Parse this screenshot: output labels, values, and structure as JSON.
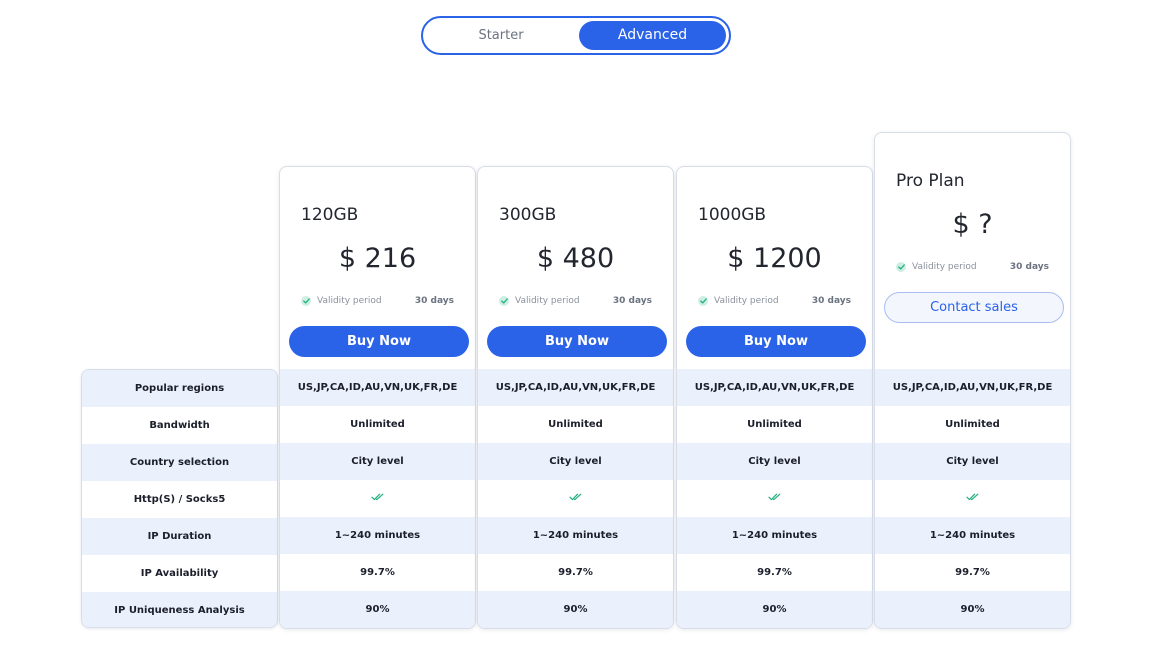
{
  "toggle": {
    "starter": "Starter",
    "advanced": "Advanced",
    "active": "advanced"
  },
  "features": [
    "Popular regions",
    "Bandwidth",
    "Country selection",
    "Http(S) / Socks5",
    "IP Duration",
    "IP Availability",
    "IP Uniqueness Analysis"
  ],
  "plans": [
    {
      "name": "120GB",
      "price": "$ 216",
      "validity_label": "Validity period",
      "validity_value": "30 days",
      "button": "Buy Now",
      "values": [
        "US,JP,CA,ID,AU,VN,UK,FR,DE",
        "Unlimited",
        "City level",
        "check",
        "1~240 minutes",
        "99.7%",
        "90%"
      ]
    },
    {
      "name": "300GB",
      "price": "$ 480",
      "validity_label": "Validity period",
      "validity_value": "30 days",
      "button": "Buy Now",
      "values": [
        "US,JP,CA,ID,AU,VN,UK,FR,DE",
        "Unlimited",
        "City level",
        "check",
        "1~240 minutes",
        "99.7%",
        "90%"
      ]
    },
    {
      "name": "1000GB",
      "price": "$ 1200",
      "validity_label": "Validity period",
      "validity_value": "30 days",
      "button": "Buy Now",
      "values": [
        "US,JP,CA,ID,AU,VN,UK,FR,DE",
        "Unlimited",
        "City level",
        "check",
        "1~240 minutes",
        "99.7%",
        "90%"
      ]
    },
    {
      "name": "Pro Plan",
      "price": "$ ?",
      "validity_label": "Validity period",
      "validity_value": "30 days",
      "button": "Contact sales",
      "values": [
        "US,JP,CA,ID,AU,VN,UK,FR,DE",
        "Unlimited",
        "City level",
        "check",
        "1~240 minutes",
        "99.7%",
        "90%"
      ]
    }
  ],
  "colors": {
    "accent": "#2a62e8",
    "row_alt": "#eaf1fd",
    "check": "#22b07d"
  }
}
